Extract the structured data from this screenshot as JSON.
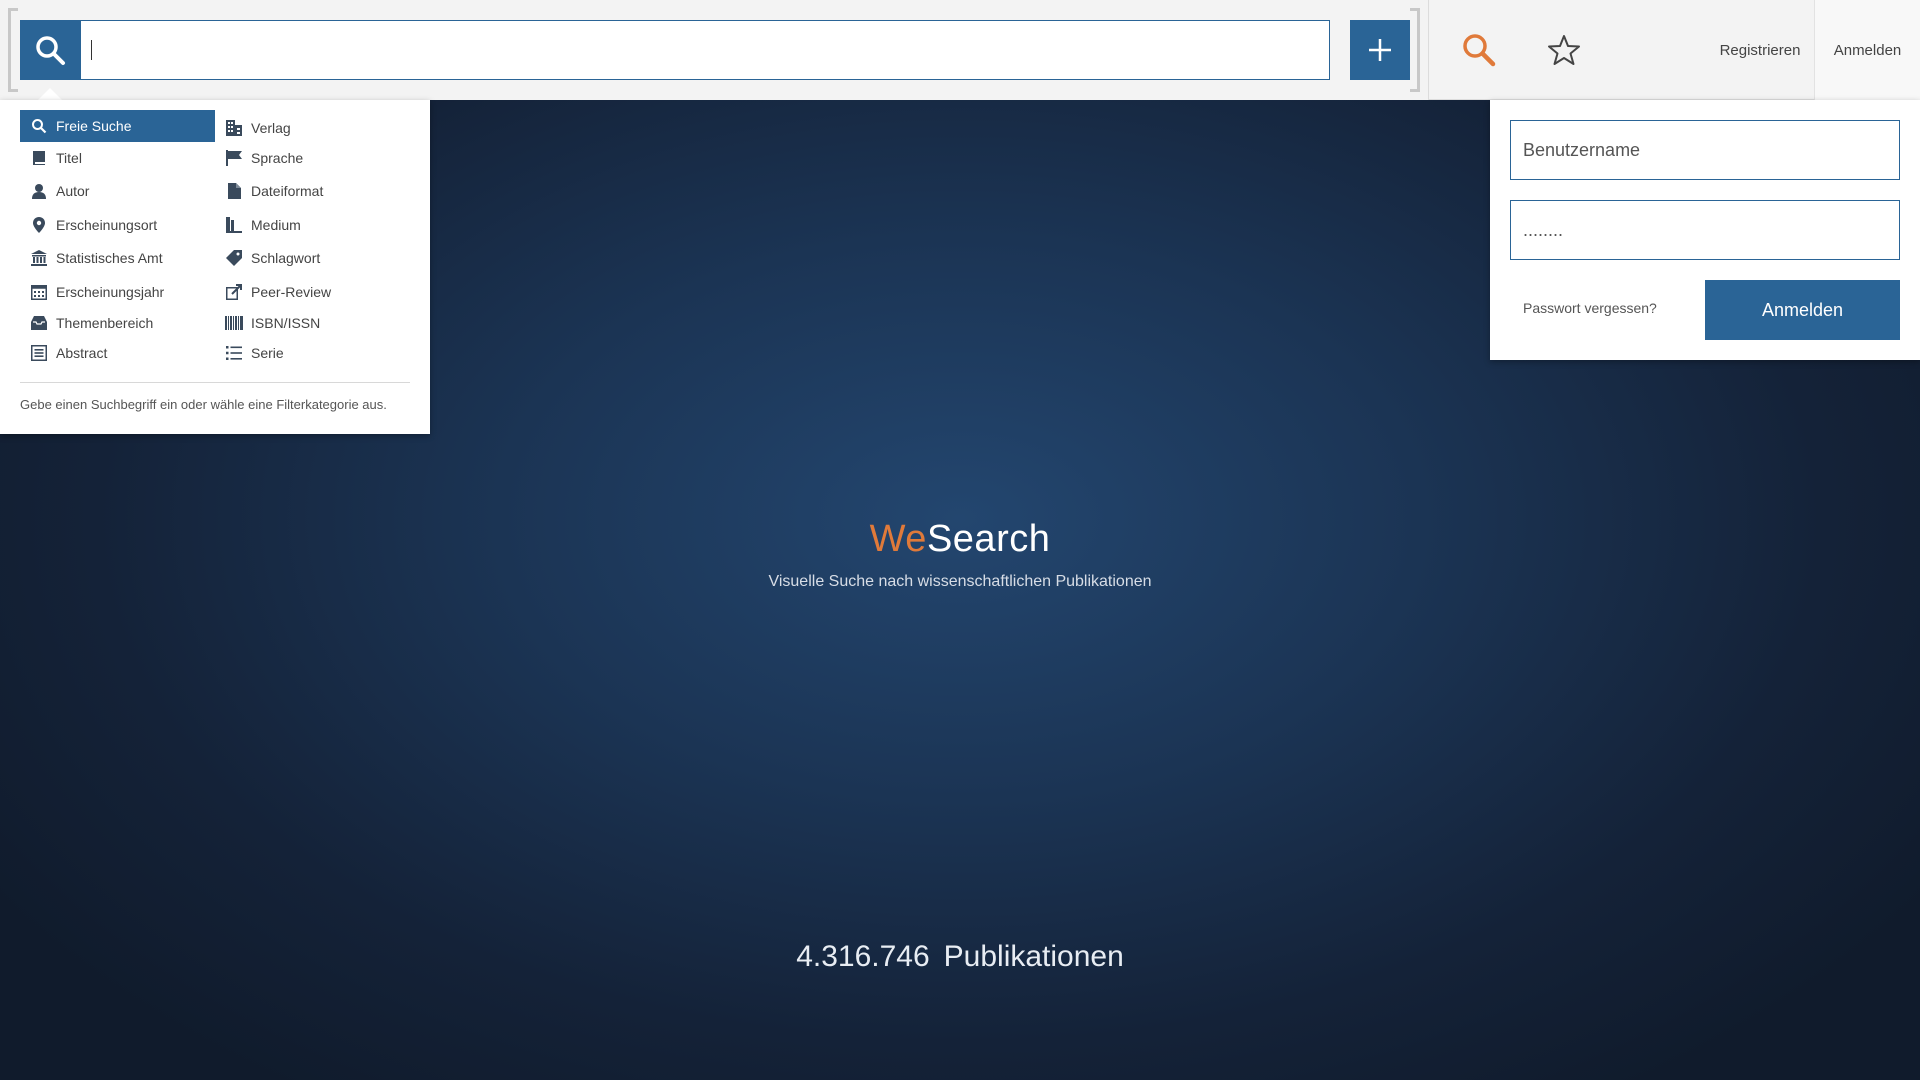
{
  "search": {
    "input_value": "",
    "add_label": "+"
  },
  "header": {
    "nav": {
      "register": "Registrieren",
      "login": "Anmelden"
    },
    "colors": {
      "accent": "#e07a3a",
      "primary": "#2a6496"
    }
  },
  "filters": {
    "items": [
      {
        "label": "Freie Suche",
        "icon": "search-icon",
        "selected": true
      },
      {
        "label": "Titel",
        "icon": "book-icon"
      },
      {
        "label": "Autor",
        "icon": "user-icon"
      },
      {
        "label": "Erscheinungsort",
        "icon": "map-marker-icon"
      },
      {
        "label": "Statistisches Amt",
        "icon": "institution-icon"
      },
      {
        "label": "Erscheinungsjahr",
        "icon": "calendar-icon"
      },
      {
        "label": "Themenbereich",
        "icon": "inbox-icon"
      },
      {
        "label": "Abstract",
        "icon": "list-alt-icon"
      },
      {
        "label": "Verlag",
        "icon": "building-icon"
      },
      {
        "label": "Sprache",
        "icon": "flag-icon"
      },
      {
        "label": "Dateiformat",
        "icon": "file-icon"
      },
      {
        "label": "Medium",
        "icon": "books-icon"
      },
      {
        "label": "Schlagwort",
        "icon": "tag-icon"
      },
      {
        "label": "Peer-Review",
        "icon": "share-icon"
      },
      {
        "label": "ISBN/ISSN",
        "icon": "barcode-icon"
      },
      {
        "label": "Serie",
        "icon": "list-icon"
      }
    ],
    "hint": "Gebe einen Suchbegriff ein oder wähle eine Filterkategorie aus."
  },
  "login": {
    "username_placeholder": "Benutzername",
    "password_value": "........",
    "forgot": "Passwort vergessen?",
    "submit": "Anmelden"
  },
  "hero": {
    "brand_we": "We",
    "brand_search": "Search",
    "subtitle": "Visuelle Suche nach wissenschaftlichen Publikationen",
    "count": "4.316.746",
    "count_label": "Publikationen"
  }
}
